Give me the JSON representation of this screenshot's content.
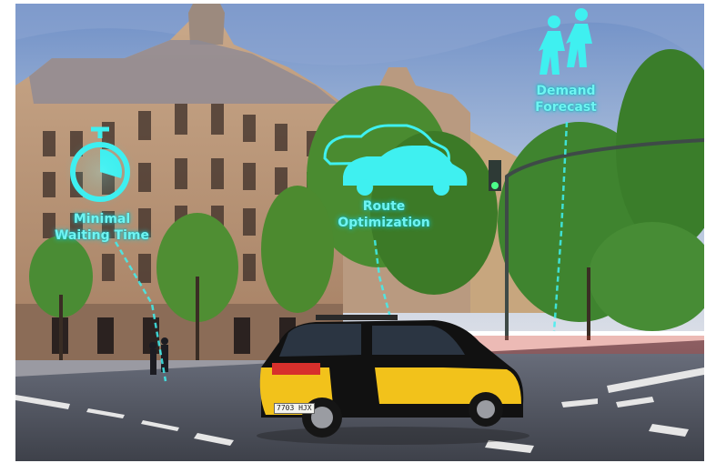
{
  "overlays": {
    "waiting": {
      "line1": "Minimal",
      "line2": "Waiting Time",
      "icon": "stopwatch-icon"
    },
    "route": {
      "line1": "Route",
      "line2": "Optimization",
      "icon": "car-icon"
    },
    "demand": {
      "line1": "Demand",
      "line2": "Forecast",
      "icon": "pedestrians-icon"
    }
  },
  "taxi": {
    "plate": "7703 HJX"
  },
  "colors": {
    "hologram": "#3ff0f0",
    "taxi_yellow": "#f2c21b",
    "taxi_black": "#111111"
  }
}
